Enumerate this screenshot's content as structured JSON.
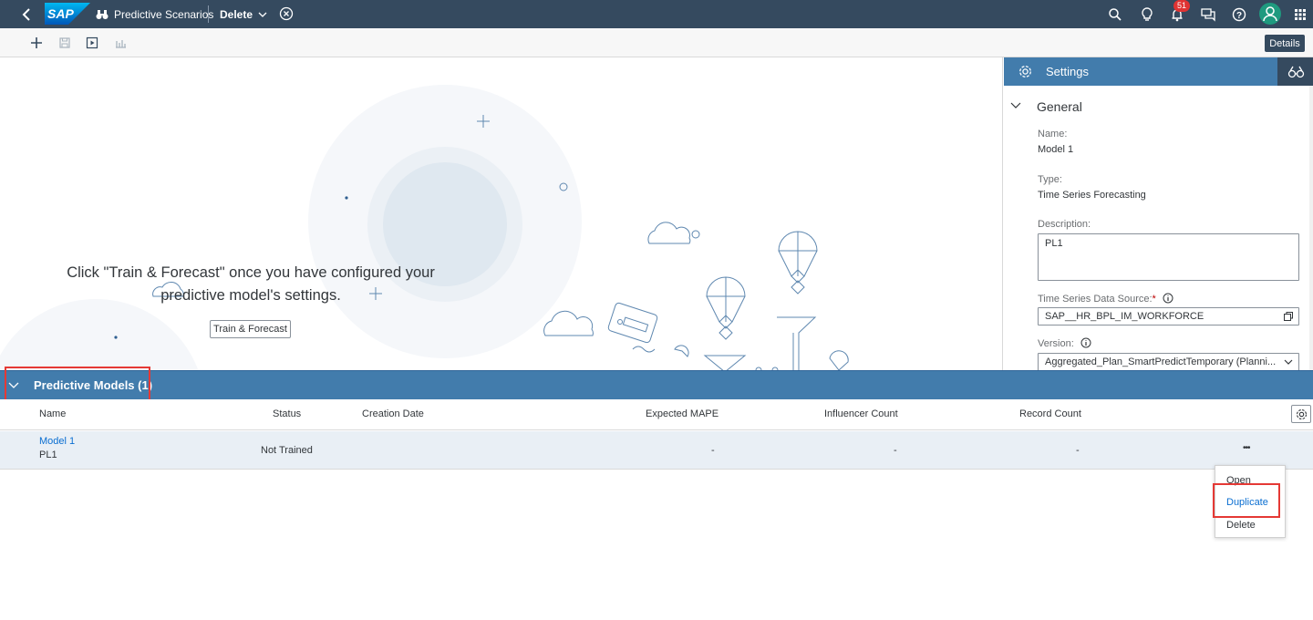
{
  "shell": {
    "logo_text": "SAP",
    "app_title": "Predictive Scenarios",
    "page_name": "Delete",
    "notification_count": "51",
    "colors": {
      "bar": "#354a5f",
      "avatar": "#1f9a7f",
      "badge": "#e03333"
    }
  },
  "toolbar": {
    "icons": [
      "add-icon",
      "save-icon",
      "run-icon",
      "chart-icon"
    ],
    "details_label": "Details"
  },
  "canvas": {
    "message": "Click \"Train & Forecast\" once you have configured your predictive model's settings.",
    "train_button_label": "Train & Forecast"
  },
  "settings": {
    "title": "Settings",
    "section": "General",
    "name_label": "Name:",
    "name_value": "Model 1",
    "type_label": "Type:",
    "type_value": "Time Series Forecasting",
    "description_label": "Description:",
    "description_value": "PL1",
    "datasource_label": "Time Series Data Source:",
    "datasource_required": "*",
    "datasource_value": "SAP__HR_BPL_IM_WORKFORCE",
    "version_label": "Version:",
    "version_value": "Aggregated_Plan_SmartPredictTemporary (Planni..."
  },
  "models": {
    "title": "Predictive Models (1)",
    "columns": {
      "name": "Name",
      "status": "Status",
      "creation_date": "Creation Date",
      "mape": "Expected MAPE",
      "influencer": "Influencer Count",
      "record": "Record Count"
    },
    "rows": [
      {
        "name": "Model 1",
        "description": "PL1",
        "status": "Not Trained",
        "creation_date": "",
        "mape": "-",
        "influencer": "-",
        "record": "-",
        "more": "•••"
      }
    ]
  },
  "context_menu": {
    "items": [
      "Open",
      "Duplicate",
      "Delete"
    ],
    "selected": "Duplicate"
  },
  "highlight_color": "#e53935"
}
